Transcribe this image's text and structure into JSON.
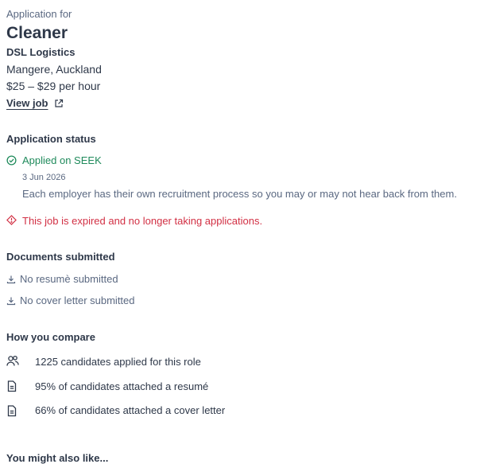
{
  "job": {
    "eyebrow": "Application for",
    "title": "Cleaner",
    "company": "DSL Logistics",
    "location": "Mangere, Auckland",
    "salary": "$25 – $29 per hour",
    "view_link": "View job"
  },
  "status": {
    "heading": "Application status",
    "applied_label": "Applied on SEEK",
    "applied_date": "3 Jun 2026",
    "note": "Each employer has their own recruitment process so you may or may not hear back from them.",
    "expired_msg": "This job is expired and no longer taking applications."
  },
  "documents": {
    "heading": "Documents submitted",
    "items": [
      {
        "label": "No resumè submitted",
        "icon": "download-icon"
      },
      {
        "label": "No cover letter submitted",
        "icon": "download-icon"
      }
    ]
  },
  "compare": {
    "heading": "How you compare",
    "items": [
      {
        "label": "1225 candidates applied for this role",
        "icon": "people-icon"
      },
      {
        "label": "95% of candidates attached a resumé",
        "icon": "document-icon"
      },
      {
        "label": "66% of candidates attached a cover letter",
        "icon": "document-icon"
      }
    ]
  },
  "more": {
    "heading": "You might also like..."
  },
  "colors": {
    "text": "#2e3849",
    "muted": "#5a6881",
    "success": "#1f8a5b",
    "critical": "#d23044"
  }
}
